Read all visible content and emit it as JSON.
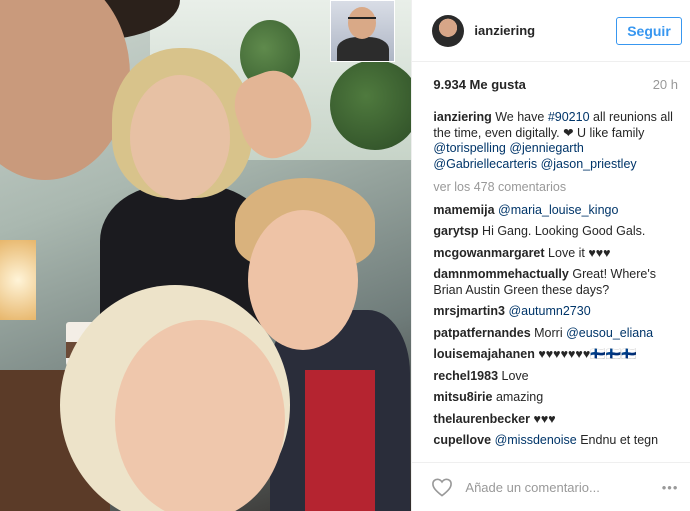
{
  "post": {
    "username": "ianziering",
    "follow_label": "Seguir",
    "likes": "9.934 Me gusta",
    "time": "20 h",
    "caption": {
      "username": "ianziering",
      "text": " We have ",
      "hashtag": "#90210",
      "text2": " all reunions all the time, even digitally. ❤ U like family ",
      "mention1": "@torispelling",
      "mention2": "@jenniegarth",
      "mention3": "@Gabriellecarteris",
      "mention4": "@jason_priestley"
    },
    "load_more": "ver los 478 comentarios",
    "comments": [
      {
        "user": "mamemija",
        "text": "",
        "mention": "@maria_louise_kingo"
      },
      {
        "user": "garytsp",
        "text": " Hi Gang. Looking Good Gals.",
        "mention": ""
      },
      {
        "user": "mcgowanmargaret",
        "text": " Love it ♥♥♥",
        "mention": ""
      },
      {
        "user": "damnmommehactually",
        "text": " Great! Where's Brian Austin Green these days?",
        "mention": ""
      },
      {
        "user": "mrsjmartin3",
        "text": "",
        "mention": "@autumn2730"
      },
      {
        "user": "patpatfernandes",
        "text": " Morri ",
        "mention": "@eusou_eliana"
      },
      {
        "user": "louisemajahanen",
        "text": " ♥♥♥♥♥♥♥🇫🇮🇫🇮🇫🇮",
        "mention": ""
      },
      {
        "user": "rechel1983",
        "text": " Love",
        "mention": ""
      },
      {
        "user": "mitsu8irie",
        "text": " amazing",
        "mention": ""
      },
      {
        "user": "thelaurenbecker",
        "text": " ♥♥♥",
        "mention": ""
      },
      {
        "user": "cupellove",
        "text": " Endnu et tegn",
        "mention": "@missdenoise"
      }
    ],
    "comment_placeholder": "Añade un comentario...",
    "more_label": "•••"
  },
  "icons": {
    "like": "heart-icon",
    "options": "more-options-icon"
  },
  "colors": {
    "link": "#003569",
    "follow": "#3897f0",
    "muted": "#999999"
  }
}
